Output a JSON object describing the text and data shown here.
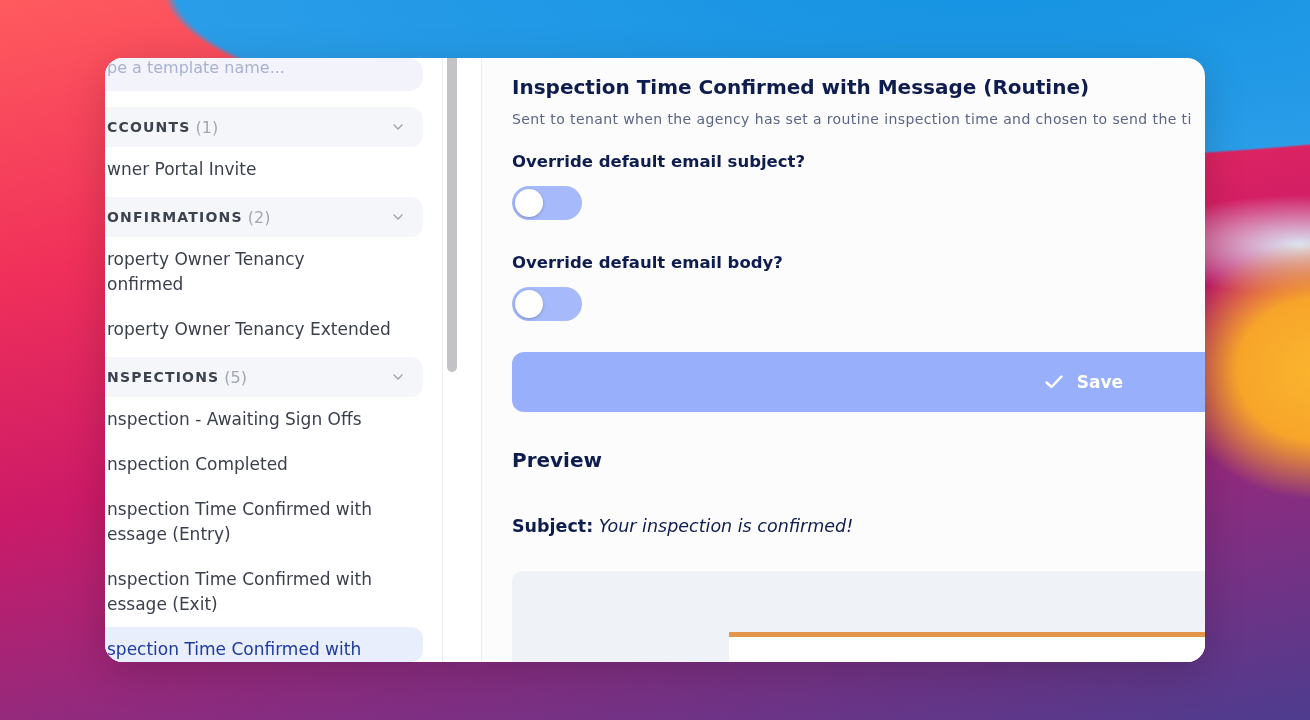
{
  "sidebar": {
    "search": {
      "placeholder": "pe a template name..."
    },
    "groups": [
      {
        "label": "CCOUNTS",
        "count": "(1)",
        "items": [
          {
            "lines": [
              "wner Portal Invite"
            ],
            "selected": false
          }
        ]
      },
      {
        "label": "ONFIRMATIONS",
        "count": "(2)",
        "items": [
          {
            "lines": [
              "roperty Owner Tenancy",
              "onfirmed"
            ],
            "selected": false
          },
          {
            "lines": [
              "roperty Owner Tenancy Extended"
            ],
            "selected": false
          }
        ]
      },
      {
        "label": "NSPECTIONS",
        "count": "(5)",
        "items": [
          {
            "lines": [
              "nspection - Awaiting Sign Offs"
            ],
            "selected": false
          },
          {
            "lines": [
              "nspection Completed"
            ],
            "selected": false
          },
          {
            "lines": [
              "nspection Time Confirmed with",
              "essage (Entry)"
            ],
            "selected": false
          },
          {
            "lines": [
              "nspection Time Confirmed with",
              "essage (Exit)"
            ],
            "selected": false
          },
          {
            "lines": [
              "spection Time Confirmed with"
            ],
            "selected": true
          }
        ]
      }
    ]
  },
  "main": {
    "title": "Inspection Time Confirmed with Message (Routine)",
    "description": "Sent to tenant when the agency has set a routine inspection time and chosen to send the ti",
    "toggles": [
      {
        "label": "Override default email subject?",
        "on": false
      },
      {
        "label": "Override default email body?",
        "on": false
      }
    ],
    "save_button": {
      "label": "Save",
      "disabled": true
    },
    "preview": {
      "heading": "Preview",
      "subject": "**Subject:** *Your inspection is confirmed!*"
    }
  }
}
